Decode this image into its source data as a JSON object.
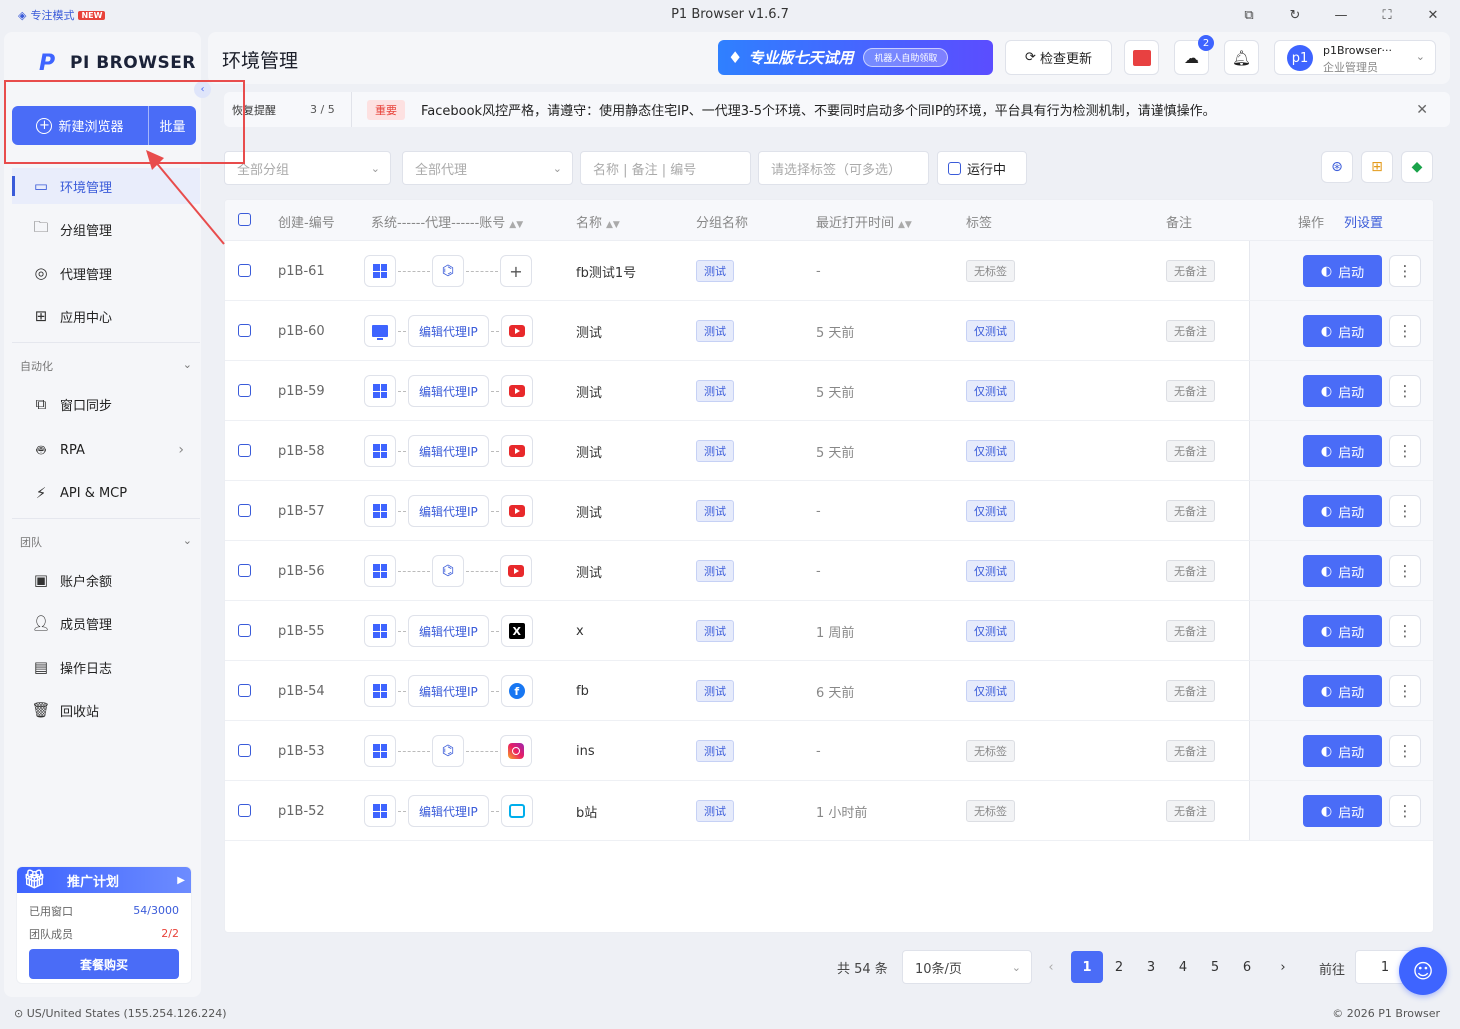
{
  "window": {
    "title": "P1 Browser v1.6.7",
    "focus_mode": "专注模式",
    "focus_badge": "NEW"
  },
  "brand": {
    "logo_mark": "P",
    "logo_text": "PI BROWSER"
  },
  "sidebar": {
    "new_browser": "新建浏览器",
    "batch": "批量",
    "items": [
      {
        "label": "环境管理",
        "icon": "monitor-icon"
      },
      {
        "label": "分组管理",
        "icon": "folder-icon"
      },
      {
        "label": "代理管理",
        "icon": "globe-icon"
      },
      {
        "label": "应用中心",
        "icon": "grid-icon"
      }
    ],
    "automation_title": "自动化",
    "automation_items": [
      {
        "label": "窗口同步",
        "icon": "sync-window-icon"
      },
      {
        "label": "RPA",
        "icon": "robot-icon"
      },
      {
        "label": "API & MCP",
        "icon": "plug-icon"
      }
    ],
    "team_title": "团队",
    "team_items": [
      {
        "label": "账户余额",
        "icon": "wallet-icon"
      },
      {
        "label": "成员管理",
        "icon": "user-icon"
      },
      {
        "label": "操作日志",
        "icon": "log-icon"
      },
      {
        "label": "回收站",
        "icon": "trash-icon"
      }
    ],
    "promo": {
      "title": "推广计划",
      "used_windows_label": "已用窗口",
      "used_windows_value": "54/3000",
      "members_label": "团队成员",
      "members_value": "2/2",
      "buy_label": "套餐购买"
    }
  },
  "header": {
    "title": "环境管理",
    "trial_text": "专业版七天试用",
    "trial_pill": "机器人自助领取",
    "check_update": "检查更新",
    "cloud_badge": "2",
    "user_name": "p1Browser···",
    "user_role": "企业管理员",
    "avatar_text": "p1"
  },
  "notice": {
    "label": "恢复提醒",
    "count": "3 / 5",
    "important": "重要",
    "message": "Facebook风控严格，请遵守：使用静态住宅IP、一代理3-5个环境、不要同时启动多个同IP的环境，平台具有行为检测机制，请谨慎操作。"
  },
  "filters": {
    "group_placeholder": "全部分组",
    "proxy_placeholder": "全部代理",
    "search_placeholder": "名称 | 备注 | 编号",
    "tags_placeholder": "请选择标签（可多选）",
    "running_label": "运行中"
  },
  "table": {
    "headers": {
      "id": "创建-编号",
      "chain": "系统------代理------账号",
      "name": "名称",
      "group": "分组名称",
      "last_open": "最近打开时间",
      "tags": "标签",
      "note": "备注",
      "ops": "操作",
      "col_settings": "列设置"
    },
    "edit_proxy_label": "编辑代理IP",
    "start_label": "启动",
    "rows": [
      {
        "id": "p1B-61",
        "os": "windows",
        "proxy": "icon",
        "account": "plus",
        "name": "fb测试1号",
        "group": "测试",
        "last_open": "-",
        "tag": "无标签",
        "note": "无备注"
      },
      {
        "id": "p1B-60",
        "os": "monitor",
        "proxy": "edit",
        "account": "youtube",
        "name": "测试",
        "group": "测试",
        "last_open": "5 天前",
        "tag": "仅测试",
        "note": "无备注"
      },
      {
        "id": "p1B-59",
        "os": "windows",
        "proxy": "edit",
        "account": "youtube",
        "name": "测试",
        "group": "测试",
        "last_open": "5 天前",
        "tag": "仅测试",
        "note": "无备注"
      },
      {
        "id": "p1B-58",
        "os": "windows",
        "proxy": "edit",
        "account": "youtube",
        "name": "测试",
        "group": "测试",
        "last_open": "5 天前",
        "tag": "仅测试",
        "note": "无备注"
      },
      {
        "id": "p1B-57",
        "os": "windows",
        "proxy": "edit",
        "account": "youtube",
        "name": "测试",
        "group": "测试",
        "last_open": "-",
        "tag": "仅测试",
        "note": "无备注"
      },
      {
        "id": "p1B-56",
        "os": "windows",
        "proxy": "icon",
        "account": "youtube",
        "name": "测试",
        "group": "测试",
        "last_open": "-",
        "tag": "仅测试",
        "note": "无备注"
      },
      {
        "id": "p1B-55",
        "os": "windows",
        "proxy": "edit",
        "account": "x",
        "name": "x",
        "group": "测试",
        "last_open": "1 周前",
        "tag": "仅测试",
        "note": "无备注"
      },
      {
        "id": "p1B-54",
        "os": "windows",
        "proxy": "edit",
        "account": "facebook",
        "name": "fb",
        "group": "测试",
        "last_open": "6 天前",
        "tag": "仅测试",
        "note": "无备注"
      },
      {
        "id": "p1B-53",
        "os": "windows",
        "proxy": "icon",
        "account": "instagram",
        "name": "ins",
        "group": "测试",
        "last_open": "-",
        "tag": "无标签",
        "note": "无备注"
      },
      {
        "id": "p1B-52",
        "os": "windows",
        "proxy": "edit",
        "account": "bilibili",
        "name": "b站",
        "group": "测试",
        "last_open": "1 小时前",
        "tag": "无标签",
        "note": "无备注"
      }
    ]
  },
  "pagination": {
    "total": "共 54 条",
    "page_size": "10条/页",
    "pages": [
      "1",
      "2",
      "3",
      "4",
      "5",
      "6"
    ],
    "current": "1",
    "goto_label": "前往",
    "goto_value": "1"
  },
  "status": {
    "location": "US/United States (155.254.126.224)",
    "copyright": "© 2026 P1 Browser"
  },
  "colors": {
    "accent": "#4a6cf7",
    "danger": "#e8433a",
    "annotation": "#e84c4c"
  }
}
